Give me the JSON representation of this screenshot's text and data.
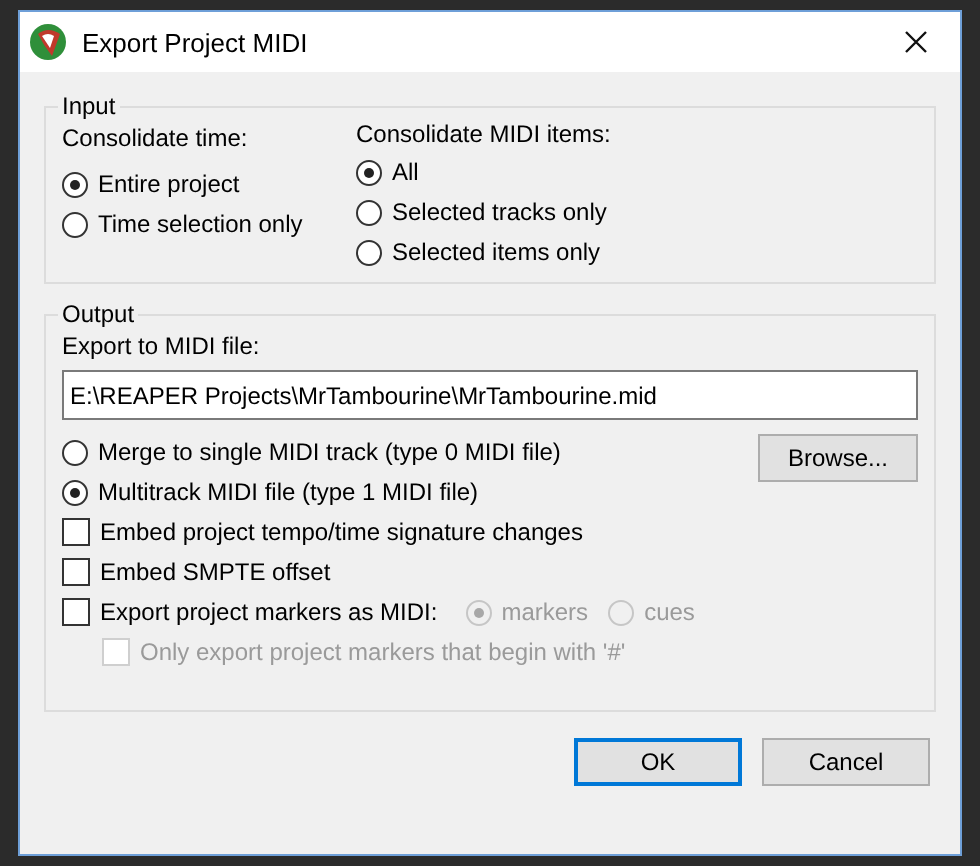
{
  "window": {
    "title": "Export Project MIDI"
  },
  "input": {
    "legend": "Input",
    "time": {
      "label": "Consolidate time:",
      "options": [
        {
          "label": "Entire project",
          "selected": true
        },
        {
          "label": "Time selection only",
          "selected": false
        }
      ]
    },
    "items": {
      "label": "Consolidate MIDI items:",
      "options": [
        {
          "label": "All",
          "selected": true
        },
        {
          "label": "Selected tracks only",
          "selected": false
        },
        {
          "label": "Selected items only",
          "selected": false
        }
      ]
    }
  },
  "output": {
    "legend": "Output",
    "file_label": "Export to MIDI file:",
    "file_path": "E:\\REAPER Projects\\MrTambourine\\MrTambourine.mid",
    "browse": "Browse...",
    "types": [
      {
        "label": "Merge to single MIDI track (type 0 MIDI file)",
        "selected": false
      },
      {
        "label": "Multitrack MIDI file (type 1 MIDI file)",
        "selected": true
      }
    ],
    "options": [
      {
        "label": "Embed project tempo/time signature changes",
        "checked": false,
        "disabled": false
      },
      {
        "label": "Embed SMPTE offset",
        "checked": false,
        "disabled": false
      },
      {
        "label": "Export project markers as MIDI:",
        "checked": false,
        "disabled": false,
        "choices": [
          {
            "label": "markers",
            "selected": true,
            "disabled": true
          },
          {
            "label": "cues",
            "selected": false,
            "disabled": true
          }
        ]
      }
    ],
    "marker_filter": {
      "label": "Only export project markers that begin with '#'",
      "checked": false,
      "disabled": true
    }
  },
  "buttons": [
    {
      "label": "OK",
      "default": true
    },
    {
      "label": "Cancel",
      "default": false
    }
  ]
}
